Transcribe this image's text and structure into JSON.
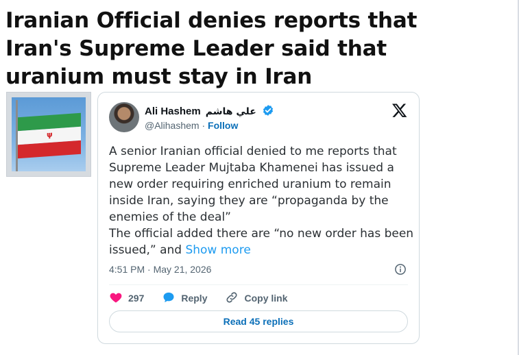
{
  "headline": "Iranian Official denies reports that Iran's Supreme Leader said that uranium must stay in Iran",
  "thumbnail": {
    "icon": "iran-flag"
  },
  "tweet": {
    "author_name": "Ali Hashem",
    "author_name_arabic": "علي هاشم",
    "handle": "@Alihashem",
    "separator": "·",
    "follow_label": "Follow",
    "body_paragraph_1": "A senior Iranian official denied to me reports that Supreme Leader Mujtaba Khamenei has issued a new order requiring enriched uranium to remain inside Iran, saying they are “propaganda by the enemies of the deal”",
    "body_paragraph_2": "The official added there are “no new order has been issued,” and",
    "show_more_label": "Show more",
    "timestamp": "4:51 PM · May 21, 2026",
    "likes_count": "297",
    "reply_label": "Reply",
    "copy_link_label": "Copy link",
    "read_replies_label": "Read 45 replies"
  },
  "colors": {
    "heart": "#f91880",
    "reply_icon": "#1d9bf0",
    "link": "#1d9bf0",
    "verified": "#1d9bf0"
  }
}
